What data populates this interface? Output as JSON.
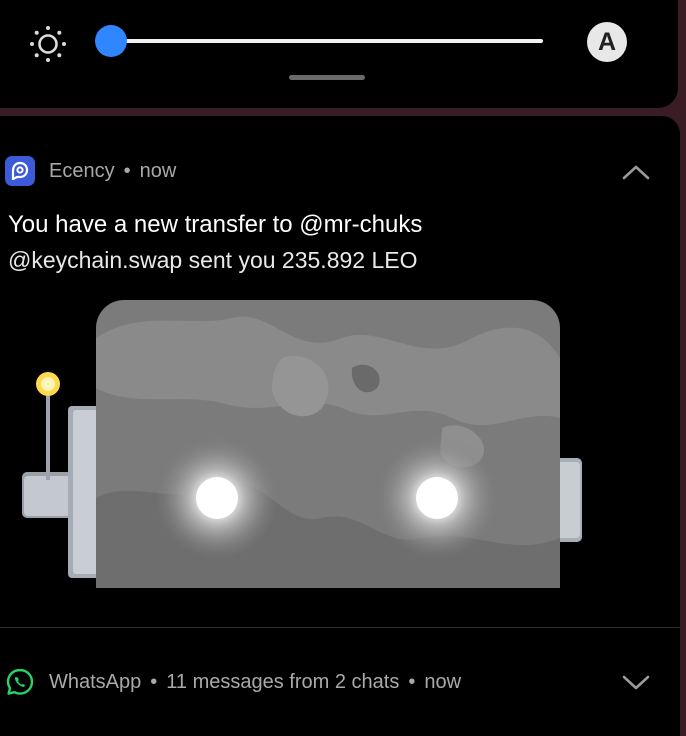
{
  "quick_settings": {
    "brightness_icon": "sun-icon",
    "brightness_level": 0.0,
    "auto_label": "A"
  },
  "notifications": [
    {
      "app": "Ecency",
      "time": "now",
      "icon": "ecency-app-icon",
      "accent": "#3b5bd9",
      "title": "You have a new transfer to @mr-chuks",
      "body": "@keychain.swap sent you 235.892 LEO",
      "expanded": true
    },
    {
      "app": "WhatsApp",
      "summary": "11 messages from 2 chats",
      "time": "now",
      "icon": "whatsapp-app-icon",
      "accent": "#25d366",
      "expanded": false
    }
  ],
  "colors": {
    "slider_thumb": "#2f86ff",
    "background": "#000000"
  }
}
